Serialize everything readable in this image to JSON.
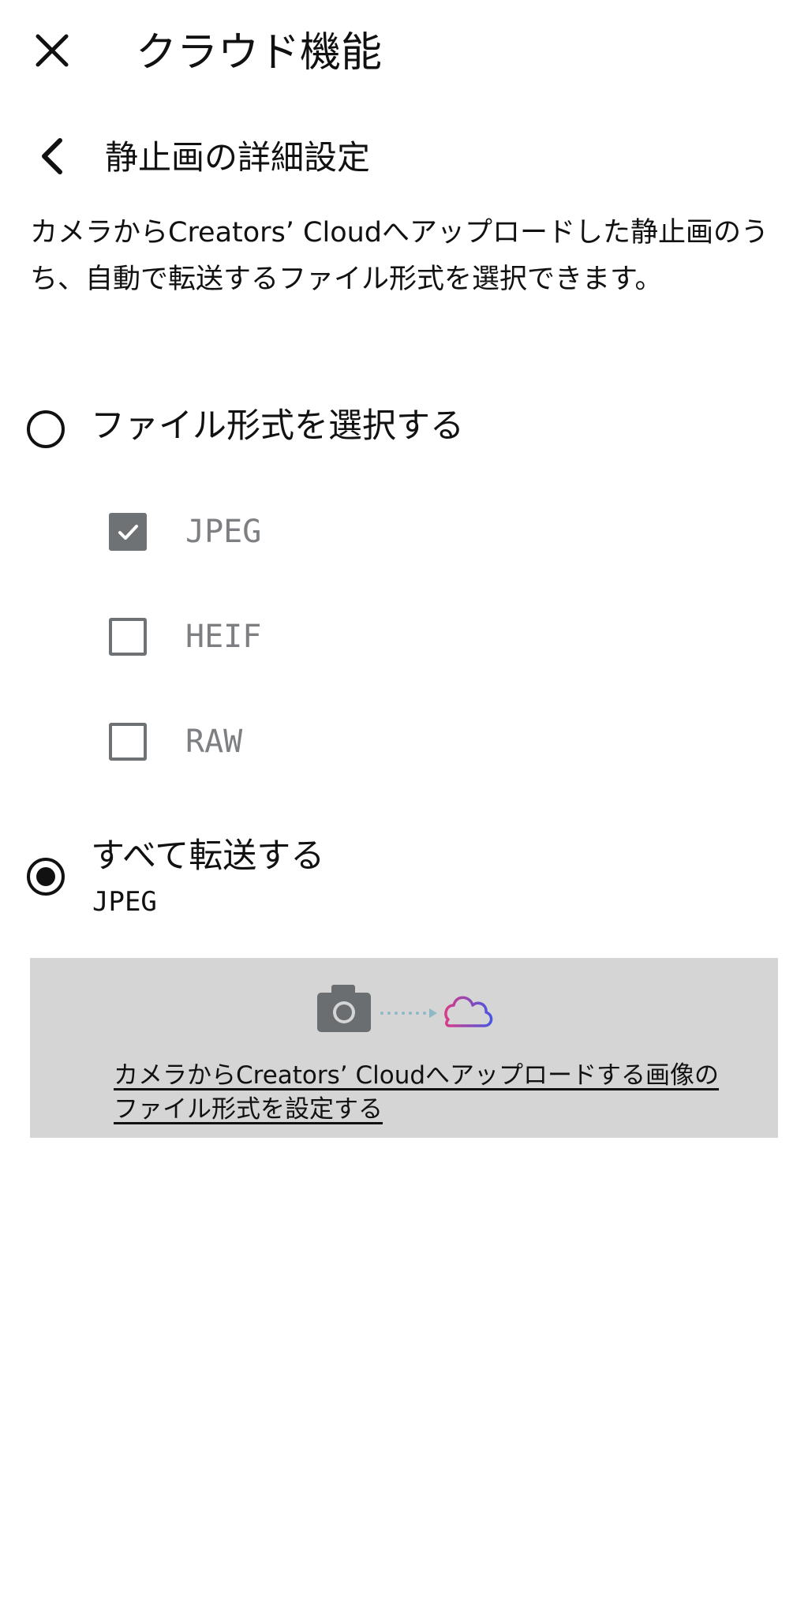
{
  "appbar": {
    "title": "クラウド機能"
  },
  "subheader": {
    "title": "静止画の詳細設定"
  },
  "description": "カメラからCreators’ Cloudへアップロードした静止画のうち、自動で転送するファイル形式を選択できます。",
  "options": {
    "select_formats": {
      "label": "ファイル形式を選択する",
      "selected": false
    },
    "transfer_all": {
      "label": "すべて転送する",
      "sublabel": "JPEG",
      "selected": true
    }
  },
  "formats": [
    {
      "label": "JPEG",
      "checked": true,
      "enabled": false
    },
    {
      "label": "HEIF",
      "checked": false,
      "enabled": false
    },
    {
      "label": "RAW",
      "checked": false,
      "enabled": false
    }
  ],
  "info_card": {
    "link_text": "カメラからCreators’ Cloudへアップロードする画像のファイル形式を設定する"
  },
  "icons": {
    "close": "close-icon",
    "back": "chevron-left-icon",
    "camera": "camera-icon",
    "cloud": "cloud-icon"
  },
  "colors": {
    "card_background": "#d5d5d5",
    "disabled_gray": "#6f7275",
    "cloud_gradient_start": "#d63b8a",
    "cloud_gradient_end": "#4a55e0"
  }
}
